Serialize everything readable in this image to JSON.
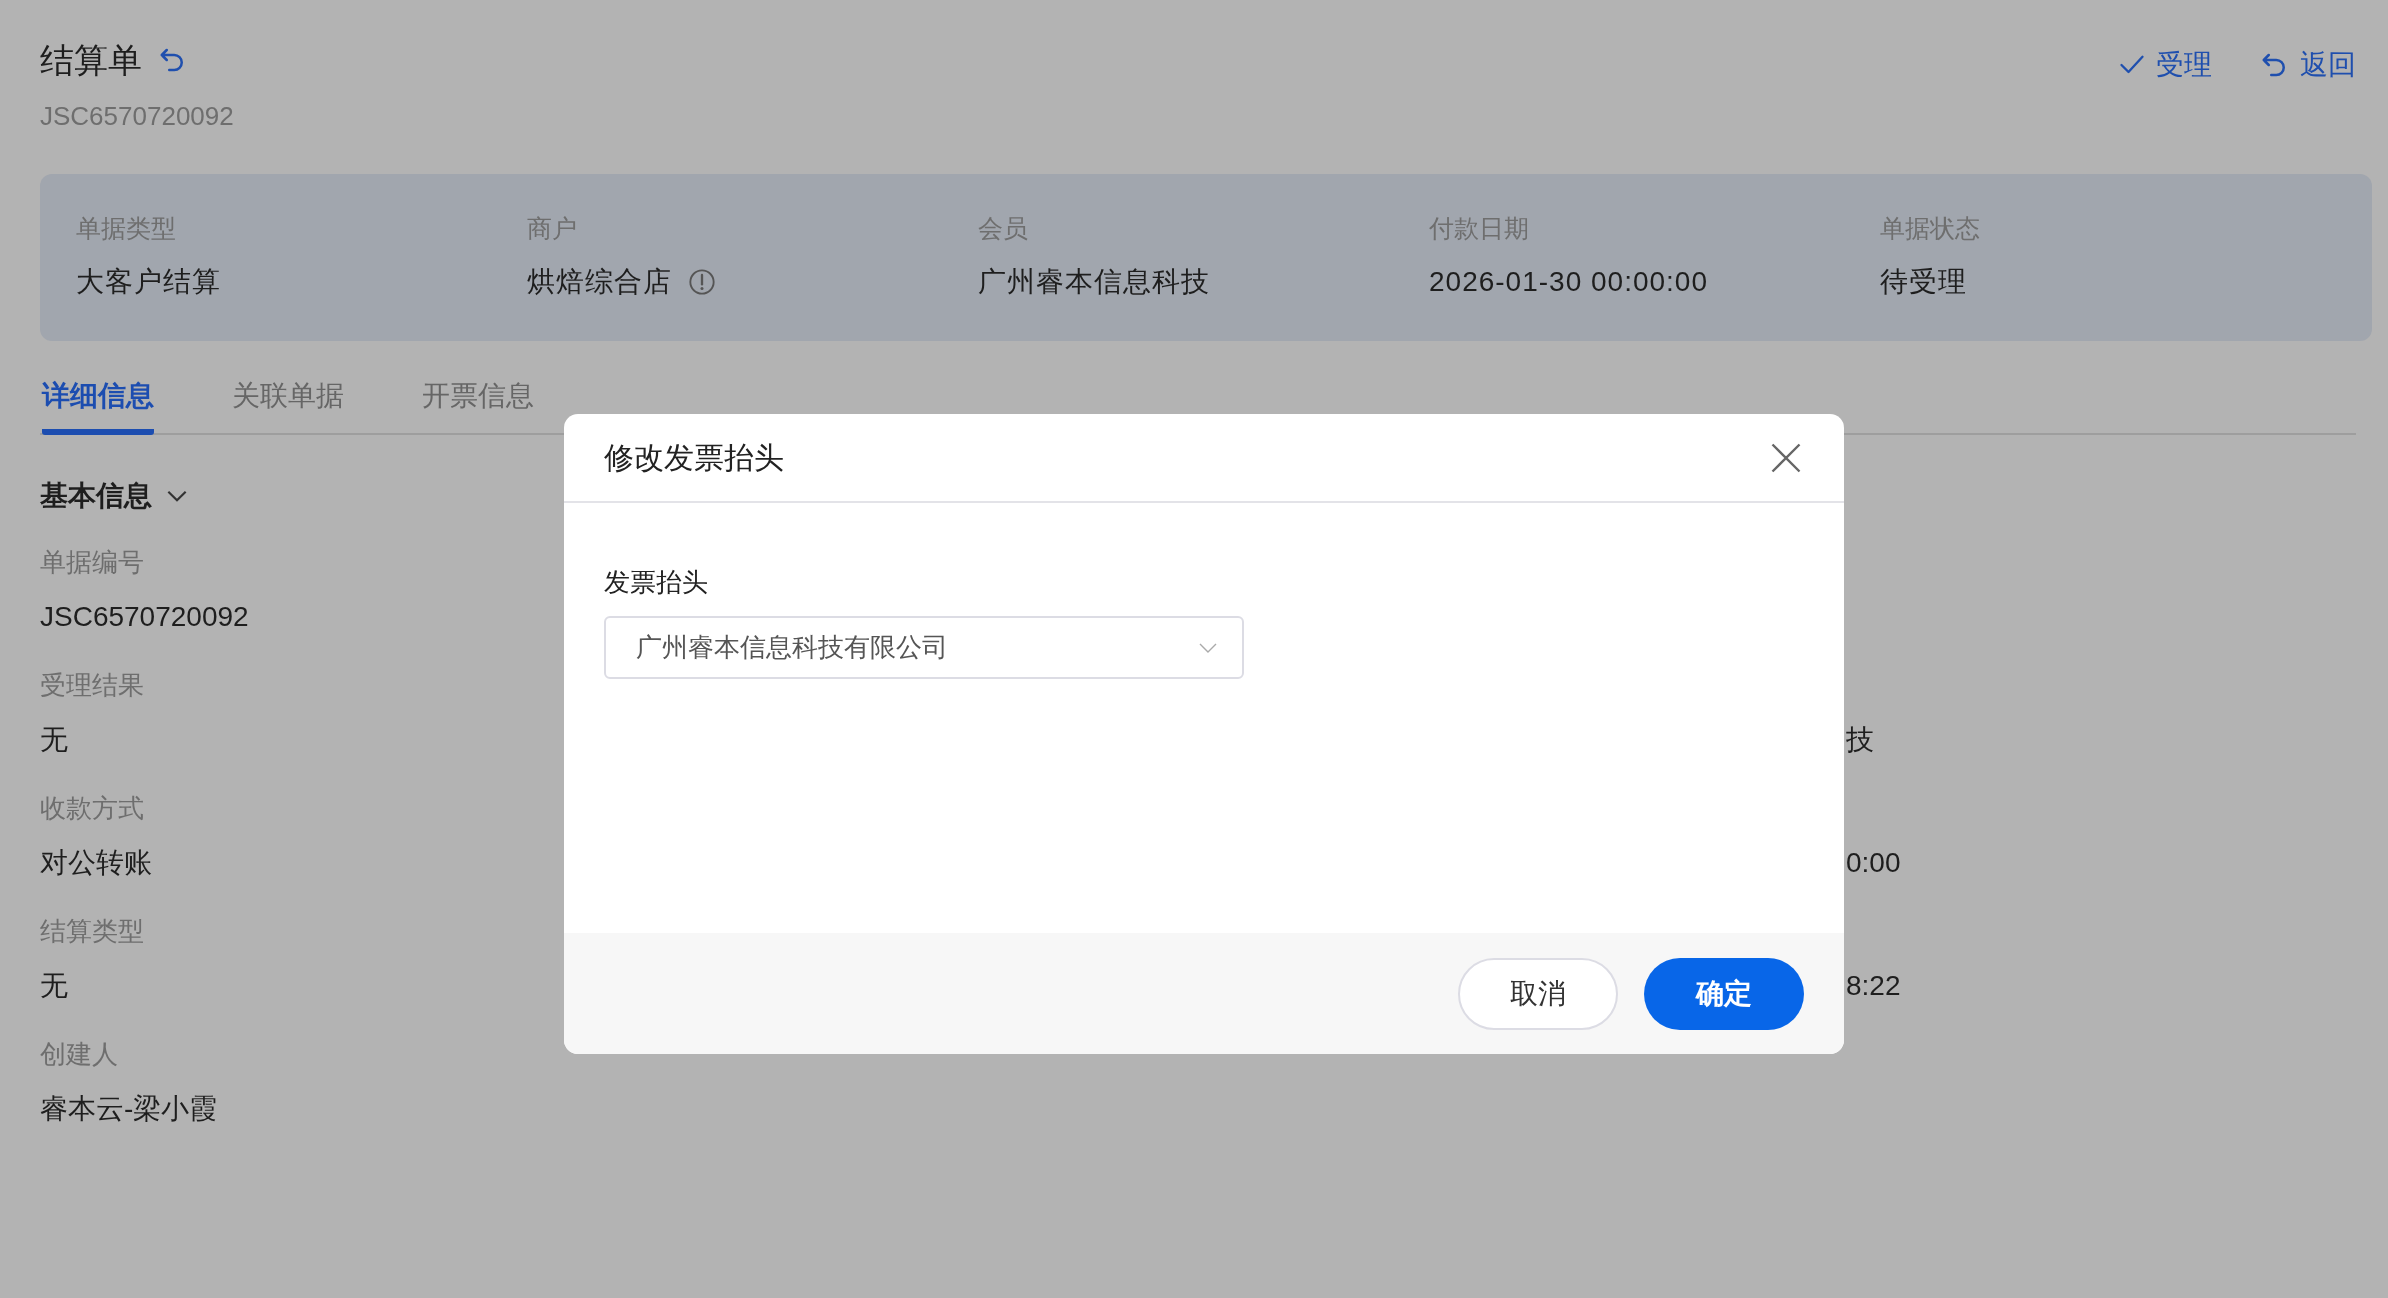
{
  "header": {
    "title": "结算单",
    "subtitle": "JSC6570720092",
    "actions": [
      {
        "kind": "check",
        "label": "受理"
      },
      {
        "kind": "back",
        "label": "返回"
      }
    ]
  },
  "summary": [
    {
      "label": "单据类型",
      "value": "大客户结算",
      "info": false
    },
    {
      "label": "商户",
      "value": "烘焙综合店",
      "info": true
    },
    {
      "label": "会员",
      "value": "广州睿本信息科技",
      "info": false
    },
    {
      "label": "付款日期",
      "value": "2026-01-30 00:00:00",
      "info": false
    },
    {
      "label": "单据状态",
      "value": "待受理",
      "info": false
    }
  ],
  "tabs": [
    {
      "label": "详细信息",
      "selected": true
    },
    {
      "label": "关联单据",
      "selected": false
    },
    {
      "label": "开票信息",
      "selected": false
    }
  ],
  "section": {
    "title": "基本信息",
    "expanded": true
  },
  "fields": [
    {
      "label": "单据编号",
      "value": "JSC6570720092"
    },
    {
      "label": "受理结果",
      "value": "无",
      "side_value": "技"
    },
    {
      "label": "收款方式",
      "value": "对公转账",
      "side_value": "0:00"
    },
    {
      "label": "结算类型",
      "value": "无",
      "side_value": "8:22"
    },
    {
      "label": "创建人",
      "value": "睿本云-梁小霞"
    }
  ],
  "dialog": {
    "title": "修改发票抬头",
    "field_label": "发票抬头",
    "field_value": "广州睿本信息科技有限公司",
    "buttons": [
      {
        "kind": "secondary",
        "label": "取消"
      },
      {
        "kind": "primary",
        "label": "确定"
      }
    ]
  }
}
